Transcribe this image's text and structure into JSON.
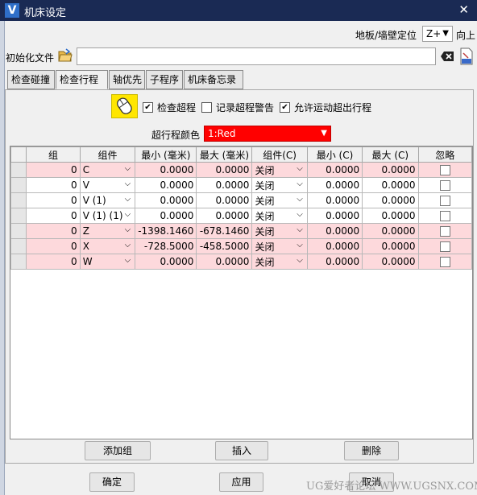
{
  "window": {
    "logo": "V",
    "title": "机床设定",
    "close_icon": "close-icon"
  },
  "orientation": {
    "label": "地板/墙壁定位",
    "axis_value": "Z+",
    "direction_label": "向上"
  },
  "init_file": {
    "label": "初始化文件",
    "value": "",
    "icons": [
      "folder-open-icon",
      "clear-icon",
      "nc-file-icon"
    ]
  },
  "tabs": [
    "检查碰撞",
    "检查行程",
    "轴优先",
    "子程序",
    "机床备忘录"
  ],
  "active_tab": "检查行程",
  "options": {
    "mouse_icon": "mouse-icon",
    "check_overtravel": "检查超程",
    "check_overtravel_checked": true,
    "record_overtravel_warning": "记录超程警告",
    "record_overtravel_warning_checked": false,
    "allow_motion_overtravel": "允许运动超出行程",
    "allow_motion_overtravel_checked": true
  },
  "overtravel_color": {
    "label": "超行程颜色",
    "value": "1:Red",
    "color": "#ff0000"
  },
  "table": {
    "columns": [
      "组",
      "组件",
      "最小 (毫米)",
      "最大 (毫米)",
      "组件(C)",
      "最小 (C)",
      "最大 (C)",
      "忽略"
    ],
    "rows": [
      {
        "group": "0",
        "component": "C",
        "min": "0.0000",
        "max": "0.0000",
        "component_c": "关闭",
        "min_c": "0.0000",
        "max_c": "0.0000",
        "ignore": false,
        "highlight": true
      },
      {
        "group": "0",
        "component": "V",
        "min": "0.0000",
        "max": "0.0000",
        "component_c": "关闭",
        "min_c": "0.0000",
        "max_c": "0.0000",
        "ignore": false,
        "highlight": false
      },
      {
        "group": "0",
        "component": "V (1)",
        "min": "0.0000",
        "max": "0.0000",
        "component_c": "关闭",
        "min_c": "0.0000",
        "max_c": "0.0000",
        "ignore": false,
        "highlight": false
      },
      {
        "group": "0",
        "component": "V (1) (1)",
        "min": "0.0000",
        "max": "0.0000",
        "component_c": "关闭",
        "min_c": "0.0000",
        "max_c": "0.0000",
        "ignore": false,
        "highlight": false
      },
      {
        "group": "0",
        "component": "Z",
        "min": "-1398.1460",
        "max": "-678.1460",
        "component_c": "关闭",
        "min_c": "0.0000",
        "max_c": "0.0000",
        "ignore": false,
        "highlight": true
      },
      {
        "group": "0",
        "component": "X",
        "min": "-728.5000",
        "max": "-458.5000",
        "component_c": "关闭",
        "min_c": "0.0000",
        "max_c": "0.0000",
        "ignore": false,
        "highlight": true
      },
      {
        "group": "0",
        "component": "W",
        "min": "0.0000",
        "max": "0.0000",
        "component_c": "关闭",
        "min_c": "0.0000",
        "max_c": "0.0000",
        "ignore": false,
        "highlight": true
      }
    ]
  },
  "panel_buttons": {
    "add_group": "添加组",
    "insert": "插入",
    "delete": "删除"
  },
  "footer_buttons": {
    "ok": "确定",
    "apply": "应用",
    "cancel": "取消"
  },
  "watermark": "UG爱好者论坛 WWW.UGSNX.COM"
}
